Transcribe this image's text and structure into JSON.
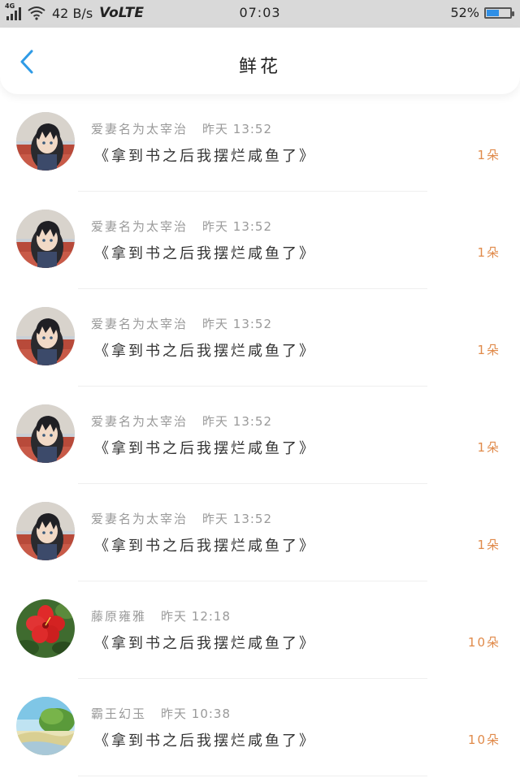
{
  "status_bar": {
    "network": "4G",
    "speed": "42 B/s",
    "volte": "VoLTE",
    "time": "07:03",
    "battery_text": "52%",
    "battery_level": 0.52,
    "battery_color": "#2f8fe6"
  },
  "header": {
    "back_icon": "chevron-left-icon",
    "title": "鲜花",
    "accent": "#2f9be6"
  },
  "items": [
    {
      "name": "爱妻名为太宰治",
      "time": "昨天 13:52",
      "book": "《拿到书之后我摆烂咸鱼了》",
      "count": "1朵",
      "avatar": "anime-character"
    },
    {
      "name": "爱妻名为太宰治",
      "time": "昨天 13:52",
      "book": "《拿到书之后我摆烂咸鱼了》",
      "count": "1朵",
      "avatar": "anime-character"
    },
    {
      "name": "爱妻名为太宰治",
      "time": "昨天 13:52",
      "book": "《拿到书之后我摆烂咸鱼了》",
      "count": "1朵",
      "avatar": "anime-character"
    },
    {
      "name": "爱妻名为太宰治",
      "time": "昨天 13:52",
      "book": "《拿到书之后我摆烂咸鱼了》",
      "count": "1朵",
      "avatar": "anime-character"
    },
    {
      "name": "爱妻名为太宰治",
      "time": "昨天 13:52",
      "book": "《拿到书之后我摆烂咸鱼了》",
      "count": "1朵",
      "avatar": "anime-character"
    },
    {
      "name": "藤原雍雅",
      "time": "昨天 12:18",
      "book": "《拿到书之后我摆烂咸鱼了》",
      "count": "10朵",
      "avatar": "red-flower"
    },
    {
      "name": "霸王幻玉",
      "time": "昨天 10:38",
      "book": "《拿到书之后我摆烂咸鱼了》",
      "count": "10朵",
      "avatar": "landscape"
    }
  ],
  "colors": {
    "count": "#e08a4a",
    "name": "#9a9a9a"
  }
}
